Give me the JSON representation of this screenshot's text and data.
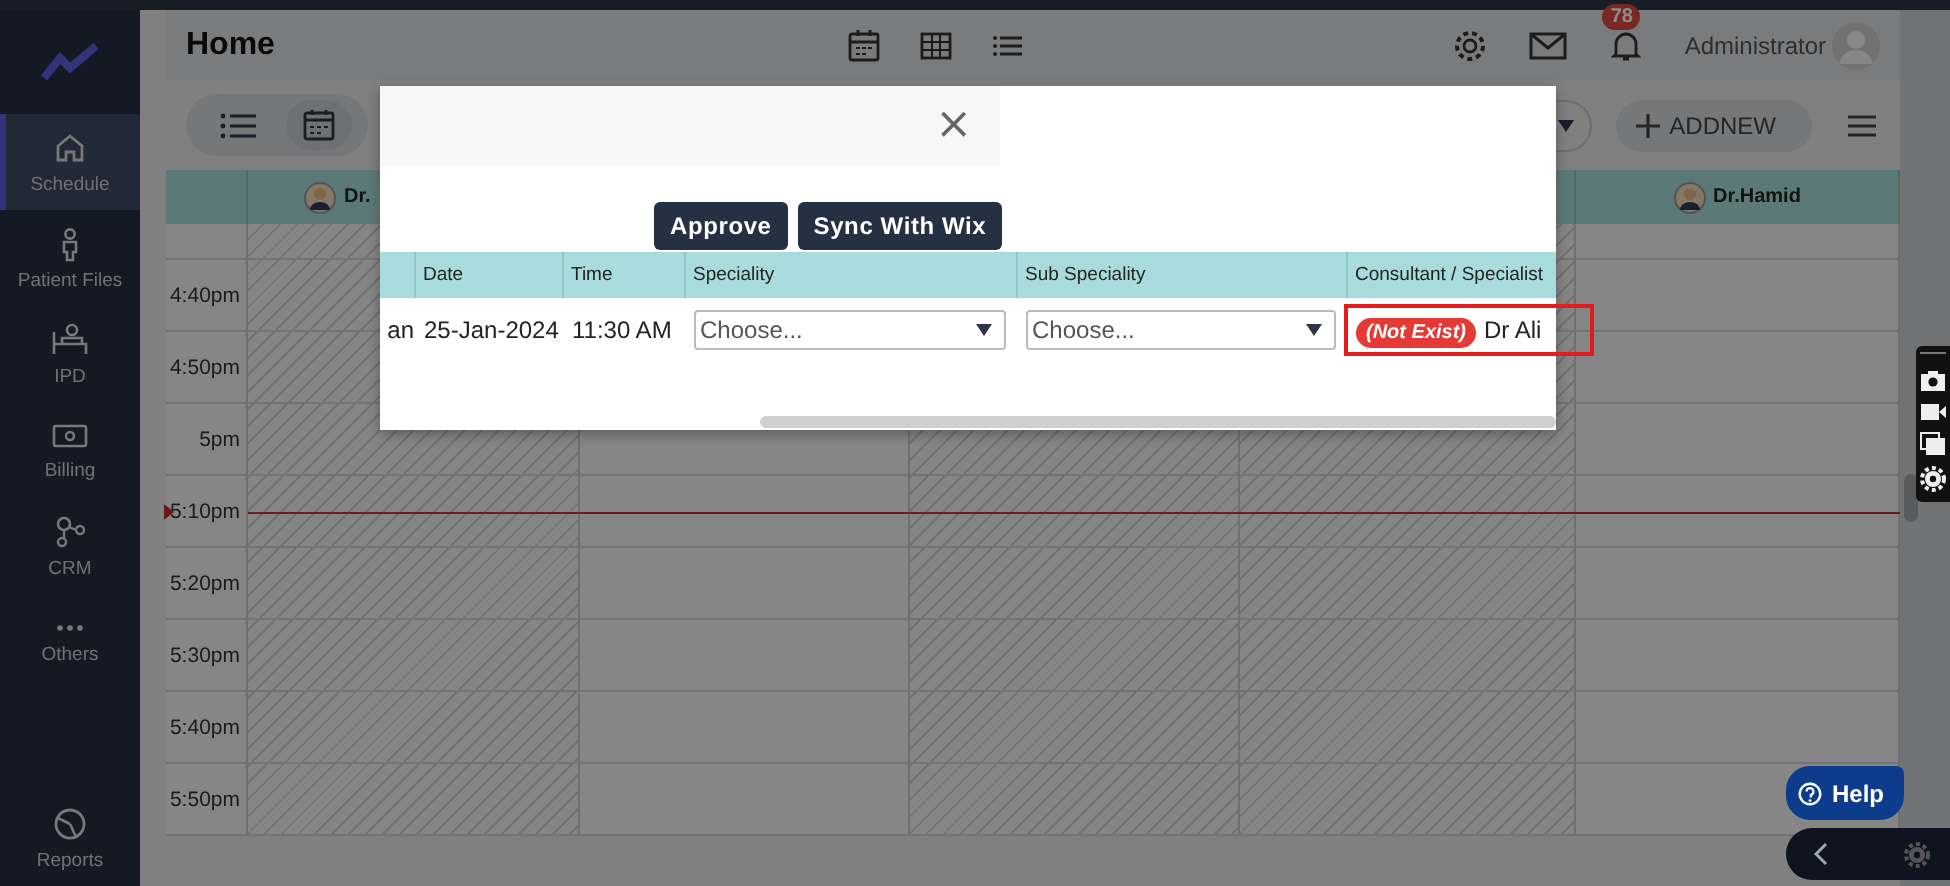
{
  "sidebar": {
    "items": [
      {
        "label": "Schedule",
        "selected": true
      },
      {
        "label": "Patient Files",
        "selected": false
      },
      {
        "label": "IPD",
        "selected": false
      },
      {
        "label": "Billing",
        "selected": false
      },
      {
        "label": "CRM",
        "selected": false
      },
      {
        "label": "Others",
        "selected": false
      },
      {
        "label": "Reports",
        "selected": false
      }
    ]
  },
  "header": {
    "title": "Home",
    "notification_count": "78",
    "user": "Administrator"
  },
  "toolbar": {
    "add_label": "ADDNEW"
  },
  "calendar": {
    "columns": [
      {
        "doctor": "Dr.",
        "unavailable": true
      },
      {
        "unavailable": false
      },
      {
        "unavailable": true
      },
      {
        "unavailable": true
      },
      {
        "doctor": "Dr.Hamid",
        "unavailable": false
      }
    ],
    "times": [
      {
        "label": "4:40pm",
        "now": false
      },
      {
        "label": "4:50pm",
        "now": false
      },
      {
        "label": "5pm",
        "now": false
      },
      {
        "label": "5:10pm",
        "now": true
      },
      {
        "label": "5:20pm",
        "now": false
      },
      {
        "label": "5:30pm",
        "now": false
      },
      {
        "label": "5:40pm",
        "now": false
      },
      {
        "label": "5:50pm",
        "now": false
      }
    ]
  },
  "modal": {
    "close": "×",
    "buttons": [
      "Approve",
      "Sync With Wix"
    ],
    "table": {
      "columns": [
        "",
        "Date",
        "Time",
        "Speciality",
        "Sub Speciality",
        "Consultant / Specialist"
      ],
      "rows": [
        {
          "cells": [
            {
              "kind": "text",
              "value": "an"
            },
            {
              "kind": "text",
              "value": "25-Jan-2024"
            },
            {
              "kind": "text",
              "value": "11:30 AM"
            },
            {
              "kind": "select",
              "placeholder": "Choose..."
            },
            {
              "kind": "select",
              "placeholder": "Choose..."
            },
            {
              "kind": "consultant",
              "badge": "(Not Exist)",
              "value": "Dr Ali",
              "flagged": true
            }
          ]
        }
      ]
    }
  },
  "help": {
    "label": "Help"
  }
}
